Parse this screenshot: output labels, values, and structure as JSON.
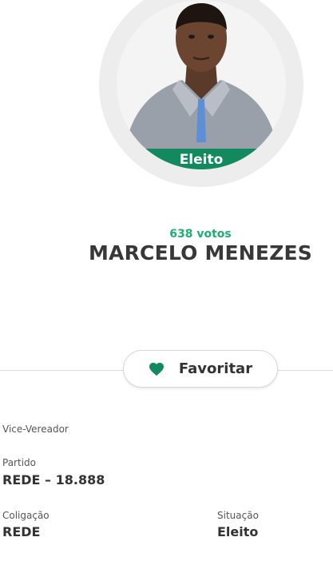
{
  "candidate": {
    "status_badge": "Eleito",
    "votes": "638 votos",
    "name": "MARCELO MENEZES"
  },
  "actions": {
    "favorite_label": "Favoritar",
    "favorite_icon": "heart-icon"
  },
  "details": {
    "role": "Vice-Vereador",
    "party_label": "Partido",
    "party_value": "REDE – 18.888",
    "coalition_label": "Coligação",
    "coalition_value": "REDE",
    "situation_label": "Situação",
    "situation_value": "Eleito"
  },
  "colors": {
    "accent_green": "#138a5e",
    "votes_green": "#1fae73"
  }
}
